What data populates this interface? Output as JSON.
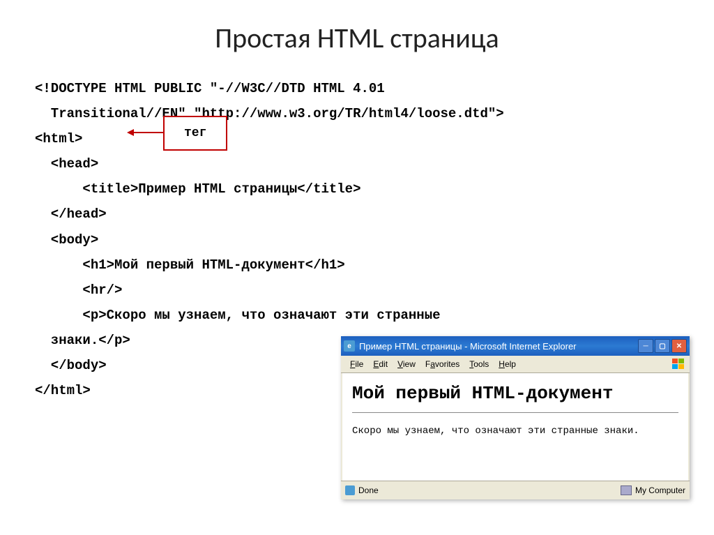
{
  "slide": {
    "title": "Простая HTML страница"
  },
  "callout": {
    "label": "тег"
  },
  "code": {
    "l1": "<!DOCTYPE HTML PUBLIC \"-//W3C//DTD HTML 4.01",
    "l2": "  Transitional//EN\" \"http://www.w3.org/TR/html4/loose.dtd\">",
    "l3": "<html>",
    "l4": "  <head>",
    "l5": "      <title>Пример HTML страницы</title>",
    "l6": "  </head>",
    "l7": "  <body>",
    "l8": "      <h1>Мой первый HTML-документ</h1>",
    "l9": "      <hr/>",
    "l10a": "      <p>Скоро мы узнаем, что означают эти странные",
    "l10b": "  знаки.</p>",
    "l11": "  </body>",
    "l12": "</html>"
  },
  "browser": {
    "title": "Пример HTML страницы - Microsoft Internet Explorer",
    "menu": {
      "file": "File",
      "edit": "Edit",
      "view": "View",
      "favorites": "Favorites",
      "tools": "Tools",
      "help": "Help"
    },
    "content": {
      "heading": "Мой первый HTML-документ",
      "paragraph": "Скоро мы узнаем, что означают эти странные знаки."
    },
    "status": {
      "done": "Done",
      "location": "My Computer"
    }
  }
}
